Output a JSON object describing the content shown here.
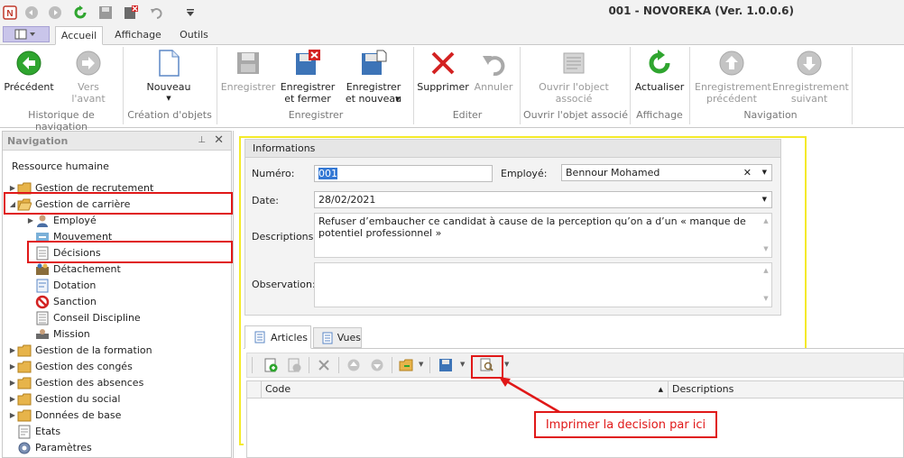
{
  "window": {
    "title": "001 - NOVOREKA (Ver. 1.0.0.6)",
    "quick_access_icons": [
      "app-logo-icon",
      "back-icon",
      "forward-icon",
      "refresh-icon",
      "save-icon",
      "save-close-icon",
      "undo-icon",
      "customize-icon"
    ]
  },
  "ribbon_tabs": [
    "Accueil",
    "Affichage",
    "Outils"
  ],
  "ribbon": {
    "buttons": {
      "precedent": "Précédent",
      "vers_avant": "Vers l'avant",
      "nouveau": "Nouveau",
      "enregistrer": "Enregistrer",
      "enregistrer_fermer": "Enregistrer\net fermer",
      "enregistrer_nouveau": "Enregistrer\net nouveau",
      "supprimer": "Supprimer",
      "annuler": "Annuler",
      "ouvrir_objet": "Ouvrir l'object\nassocié",
      "actualiser": "Actualiser",
      "enreg_precedent": "Enregistrement\nprécédent",
      "enreg_suivant": "Enregistrement\nsuivant"
    },
    "groups": {
      "historique": "Historique de navigation",
      "creation": "Création d'objets",
      "enregistrer": "Enregistrer",
      "editer": "Editer",
      "ouvrir": "Ouvrir l'objet associé",
      "affichage": "Affichage",
      "navigation": "Navigation"
    }
  },
  "nav": {
    "title": "Navigation",
    "pin_glyph": "⊥",
    "close_glyph": "✕",
    "section": "Ressource humaine",
    "items": [
      {
        "label": "Gestion de recrutement"
      },
      {
        "label": "Gestion de carrière"
      },
      {
        "label": "Employé"
      },
      {
        "label": "Mouvement"
      },
      {
        "label": "Décisions"
      },
      {
        "label": "Détachement"
      },
      {
        "label": "Dotation"
      },
      {
        "label": "Sanction"
      },
      {
        "label": "Conseil Discipline"
      },
      {
        "label": "Mission"
      },
      {
        "label": "Gestion de la formation"
      },
      {
        "label": "Gestion des congés"
      },
      {
        "label": "Gestion des absences"
      },
      {
        "label": "Gestion du social"
      },
      {
        "label": "Données de base"
      },
      {
        "label": "Etats"
      },
      {
        "label": "Paramètres"
      }
    ]
  },
  "form": {
    "group_title": "Informations",
    "numero_label": "Numéro:",
    "numero_value": "001",
    "employe_label": "Employé:",
    "employe_value": "Bennour Mohamed",
    "date_label": "Date:",
    "date_value": "28/02/2021",
    "descriptions_label": "Descriptions:",
    "descriptions_value": "Refuser d’embaucher ce candidat à cause de la perception qu’on a d’un « manque de potentiel professionnel »",
    "observation_label": "Observation:",
    "observation_value": ""
  },
  "detail_tabs": [
    "Articles",
    "Vues"
  ],
  "grid": {
    "columns": [
      "Code",
      "Descriptions"
    ]
  },
  "annotation": {
    "text": "Imprimer la decision par ici"
  },
  "colors": {
    "highlight_red": "#e01818",
    "highlight_yellow": "#f4ea2a",
    "app_menu": "#c9c5ea",
    "accent_green": "#2fa52f",
    "delete_red": "#d32222"
  }
}
